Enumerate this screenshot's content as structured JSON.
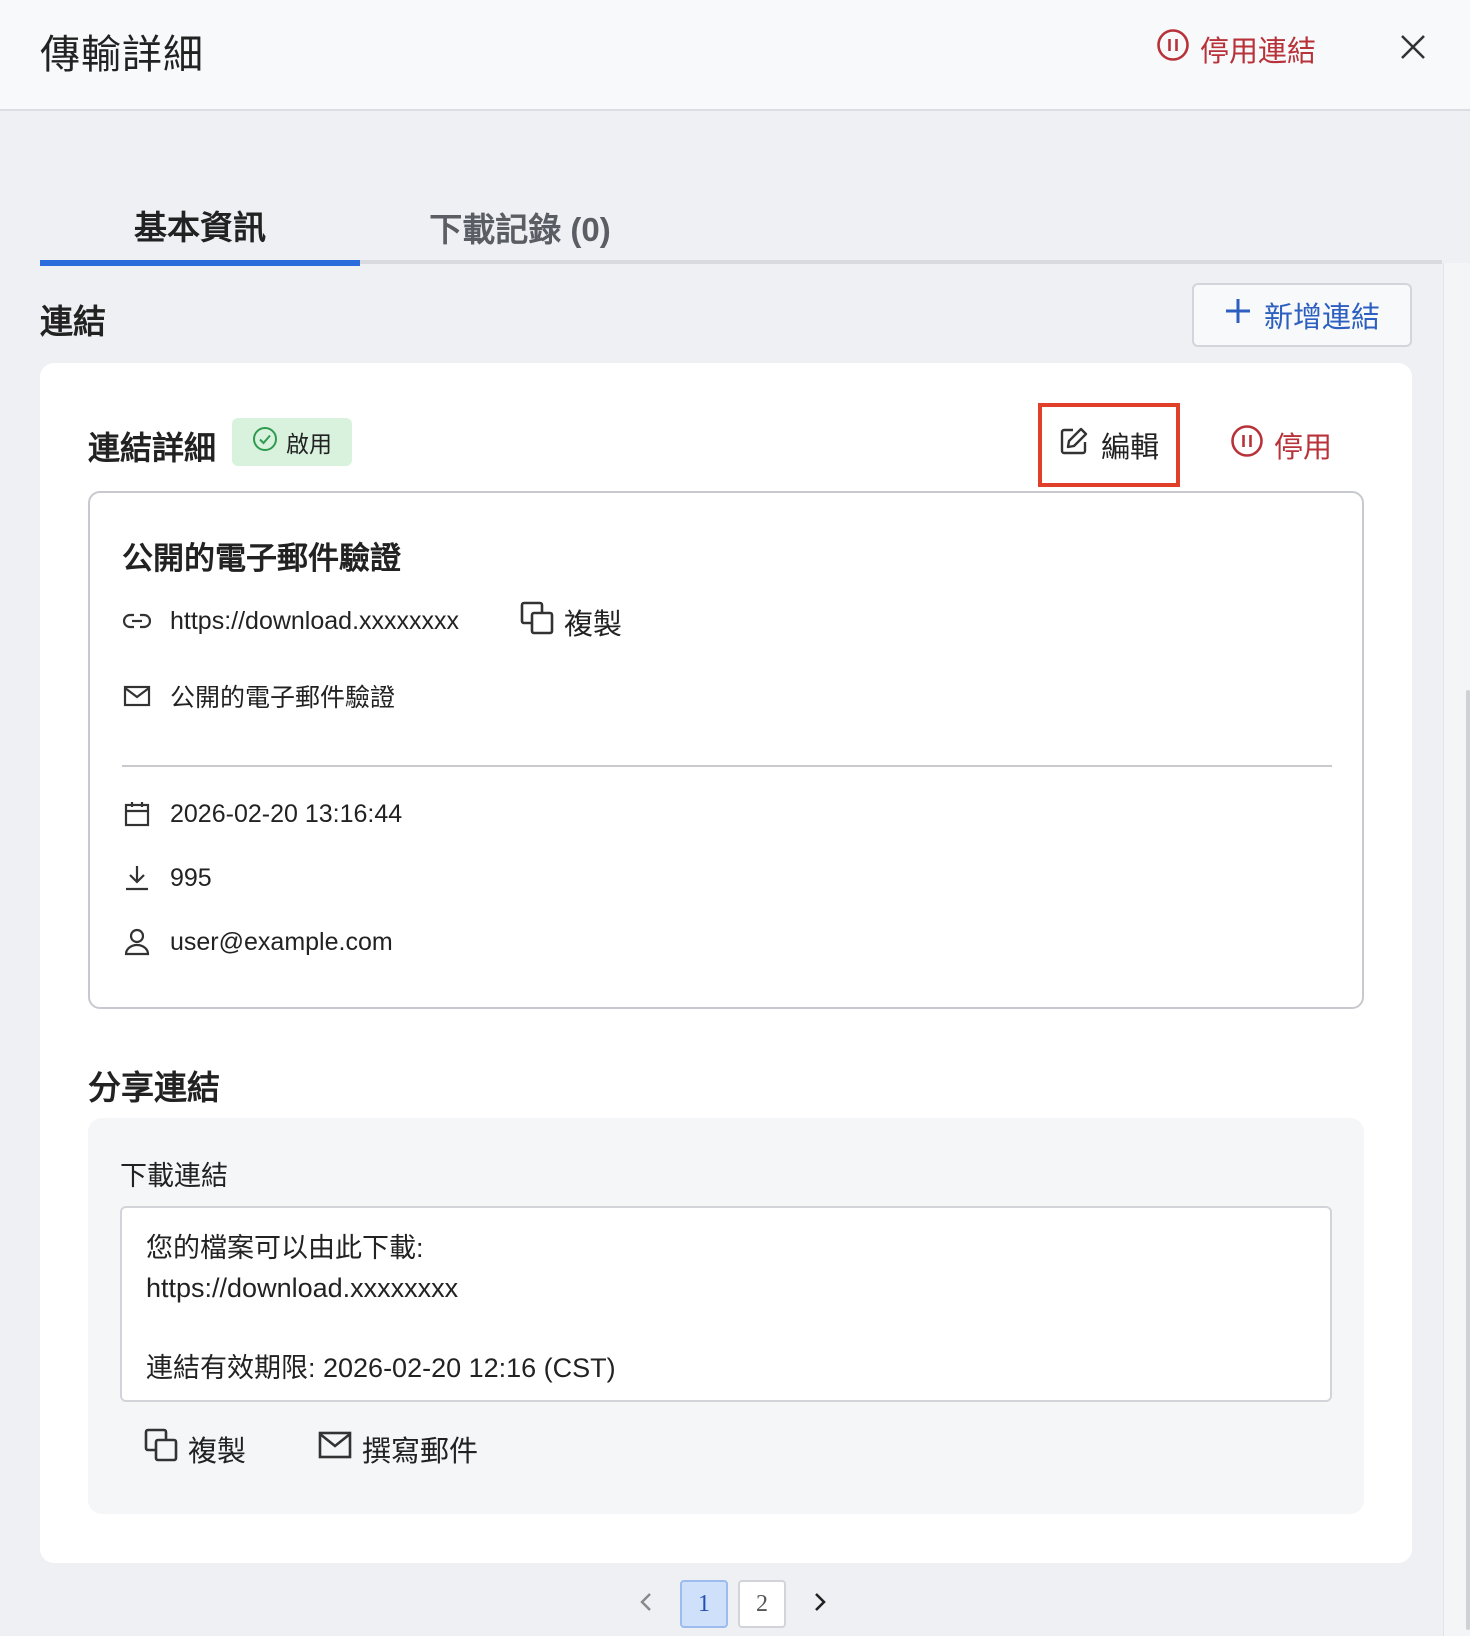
{
  "header": {
    "title": "傳輸詳細",
    "disable_link_label": "停用連結"
  },
  "tabs": [
    {
      "label": "基本資訊",
      "active": true
    },
    {
      "label": "下載記錄 (0)",
      "active": false
    }
  ],
  "section": {
    "title": "連結",
    "add_link_label": "新增連結"
  },
  "link_detail": {
    "title": "連結詳細",
    "status": "啟用",
    "edit_label": "編輯",
    "disable_label": "停用",
    "name": "公開的電子郵件驗證",
    "url": "https://download.xxxxxxxx",
    "copy_label": "複製",
    "verification": "公開的電子郵件驗證",
    "date": "2026-02-20 13:16:44",
    "downloads": "995",
    "owner": "user@example.com"
  },
  "share": {
    "title": "分享連結",
    "label": "下載連結",
    "message": "您的檔案可以由此下載:\nhttps://download.xxxxxxxx\n\n連結有效期限: 2026-02-20 12:16 (CST)",
    "copy_label": "複製",
    "email_label": "撰寫郵件"
  },
  "pagination": {
    "pages": [
      "1",
      "2"
    ],
    "current": "1"
  },
  "colors": {
    "accent": "#2c6bdc",
    "danger": "#b8323a",
    "success_bg": "#d9f2de",
    "highlight": "#e0402a"
  },
  "icons": [
    "pause-circle-icon",
    "close-icon",
    "plus-icon",
    "check-circle-icon",
    "edit-icon",
    "link-icon",
    "copy-icon",
    "mail-icon",
    "calendar-icon",
    "download-icon",
    "user-icon",
    "chevron-left-icon",
    "chevron-right-icon"
  ]
}
